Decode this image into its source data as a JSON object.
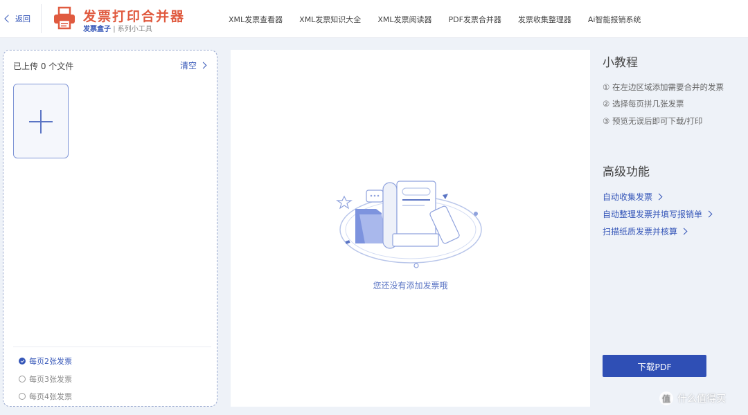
{
  "header": {
    "back_label": "返回",
    "brand_title": "发票打印合并器",
    "brand_sub_strong": "发票盒子",
    "brand_sub_sep": "|",
    "brand_sub_rest": "系列小工具",
    "nav": [
      "XML发票查看器",
      "XML发票知识大全",
      "XML发票阅读器",
      "PDF发票合并器",
      "发票收集整理器",
      "Ai智能报销系统"
    ]
  },
  "left_panel": {
    "upload_count": "已上传 0 个文件",
    "clear_label": "清空",
    "options": [
      {
        "label": "每页2张发票",
        "selected": true
      },
      {
        "label": "每页3张发票",
        "selected": false
      },
      {
        "label": "每页4张发票",
        "selected": false
      }
    ]
  },
  "preview": {
    "empty_text": "您还没有添加发票哦"
  },
  "right_panel": {
    "tutorial_title": "小教程",
    "steps": [
      "① 在左边区域添加需要合并的发票",
      "② 选择每页拼几张发票",
      "③ 预览无误后即可下载/打印"
    ],
    "advanced_title": "高级功能",
    "advanced_links": [
      "自动收集发票",
      "自动整理发票并填写报销单",
      "扫描纸质发票并核算"
    ],
    "download_label": "下载PDF"
  },
  "watermark": {
    "logo_char": "值",
    "text": "什么值得买"
  },
  "colors": {
    "accent": "#3556b8",
    "brand": "#e05a3f",
    "button": "#2f4fb5",
    "background": "#eef2f8"
  }
}
